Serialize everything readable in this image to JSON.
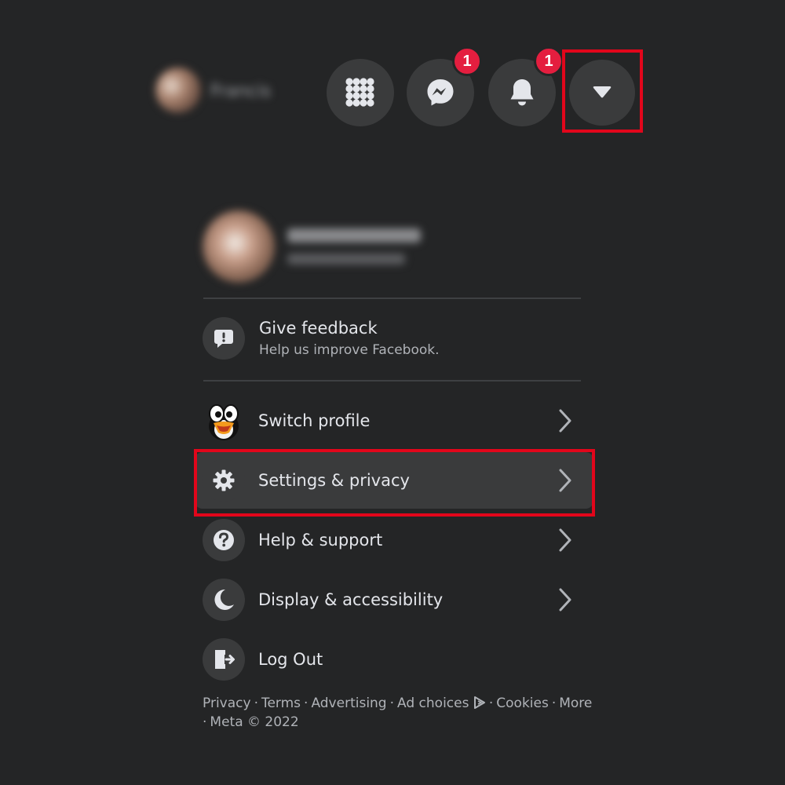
{
  "nav": {
    "profile_name": "Francis",
    "messenger_badge": "1",
    "notifications_badge": "1",
    "icons": {
      "menu": "grid-menu-icon",
      "messenger": "messenger-icon",
      "notifications": "bell-icon",
      "account": "caret-down-icon"
    }
  },
  "dropdown": {
    "feedback": {
      "title": "Give feedback",
      "subtitle": "Help us improve Facebook."
    },
    "items": [
      {
        "label": "Switch profile",
        "icon": "penguin-avatar-icon"
      },
      {
        "label": "Settings & privacy",
        "icon": "gear-icon"
      },
      {
        "label": "Help & support",
        "icon": "question-icon"
      },
      {
        "label": "Display & accessibility",
        "icon": "moon-icon"
      },
      {
        "label": "Log Out",
        "icon": "logout-icon"
      }
    ]
  },
  "footer": {
    "links": [
      "Privacy",
      "Terms",
      "Advertising",
      "Ad choices",
      "Cookies",
      "More"
    ],
    "copyright": "Meta © 2022"
  },
  "colors": {
    "background": "#242526",
    "surface": "#3a3b3c",
    "text_primary": "#e4e6eb",
    "text_secondary": "#b0b3b8",
    "badge": "#e41e3f",
    "highlight": "#e2061b"
  }
}
